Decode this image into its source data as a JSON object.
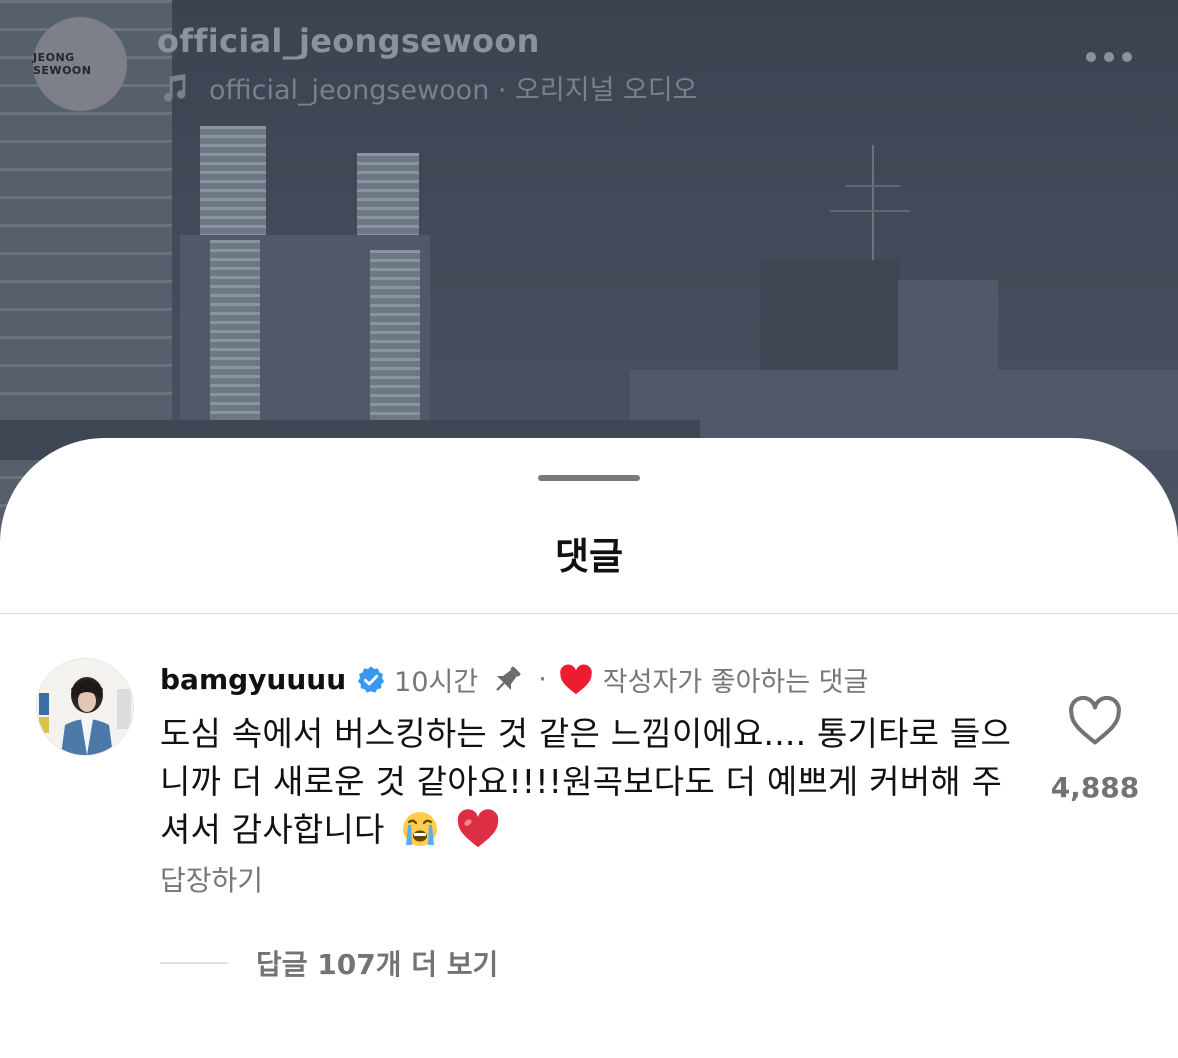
{
  "header": {
    "avatar_text": "JEONG SEWOON",
    "username": "official_jeongsewoon",
    "audio_label": "official_jeongsewoon · 오리지널 오디오"
  },
  "sheet": {
    "title": "댓글"
  },
  "comment": {
    "username": "bamgyuuuu",
    "time": "10시간",
    "separator": "·",
    "author_liked": "작성자가 좋아하는 댓글",
    "text": "도심 속에서 버스킹하는 것 같은 느낌이에요.... 통기타로 들으니까 더 새로운 것 같아요!!!!원곡보다도 더 예쁘게 커버해 주셔서 감사합니다",
    "like_count": "4,888",
    "reply_label": "답장하기",
    "more_replies": "답글 107개 더 보기"
  },
  "colors": {
    "verified": "#3897f0",
    "heart": "#ed1d2f"
  }
}
